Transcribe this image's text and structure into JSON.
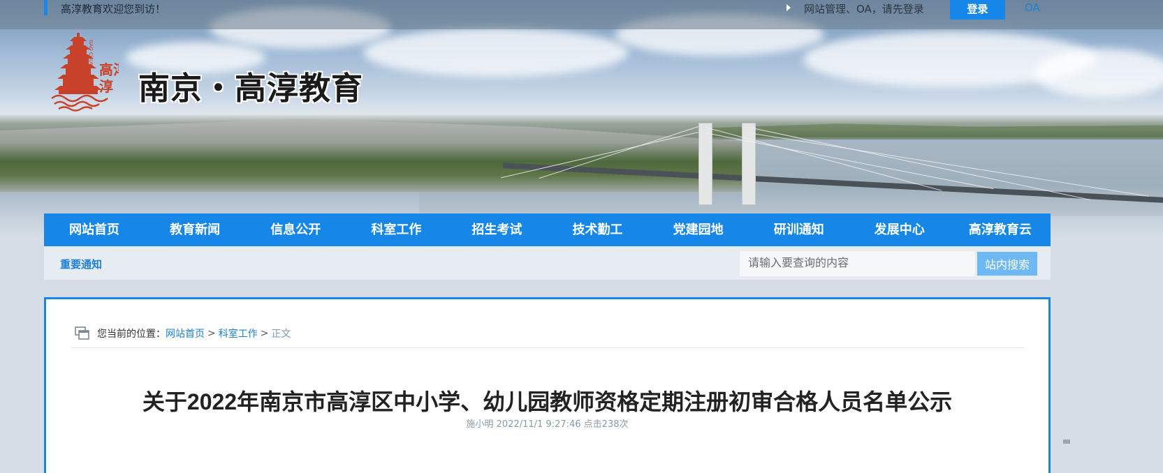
{
  "topbar": {
    "welcome": "高淳教育欢迎您到访！",
    "login_hint": "网站管理、OA，请先登录",
    "login_button": "登录",
    "oa_link": "OA"
  },
  "header": {
    "logo_text": "高淳",
    "logo_romanized": "GAO CHUN",
    "site_title": "南京・高淳教育"
  },
  "nav": {
    "items": [
      "网站首页",
      "教育新闻",
      "信息公开",
      "科室工作",
      "招生考试",
      "技术勤工",
      "党建园地",
      "研训通知",
      "发展中心",
      "高淳教育云"
    ]
  },
  "notice_bar": {
    "notice_label": "重要通知",
    "search_placeholder": "请输入要查询的内容",
    "search_button": "站内搜索"
  },
  "breadcrumb": {
    "prefix": "您当前的位置：",
    "home": "网站首页",
    "section": "科室工作",
    "current": "正文",
    "separator": ">"
  },
  "article": {
    "title": "关于2022年南京市高淳区中小学、幼儿园教师资格定期注册初审合格人员名单公示",
    "meta": "施小明 2022/11/1 9:27:46 点击238次"
  },
  "colors": {
    "brand_blue": "#1687e8",
    "link_blue": "#1d7fd6",
    "logo_red": "#c8422b"
  }
}
